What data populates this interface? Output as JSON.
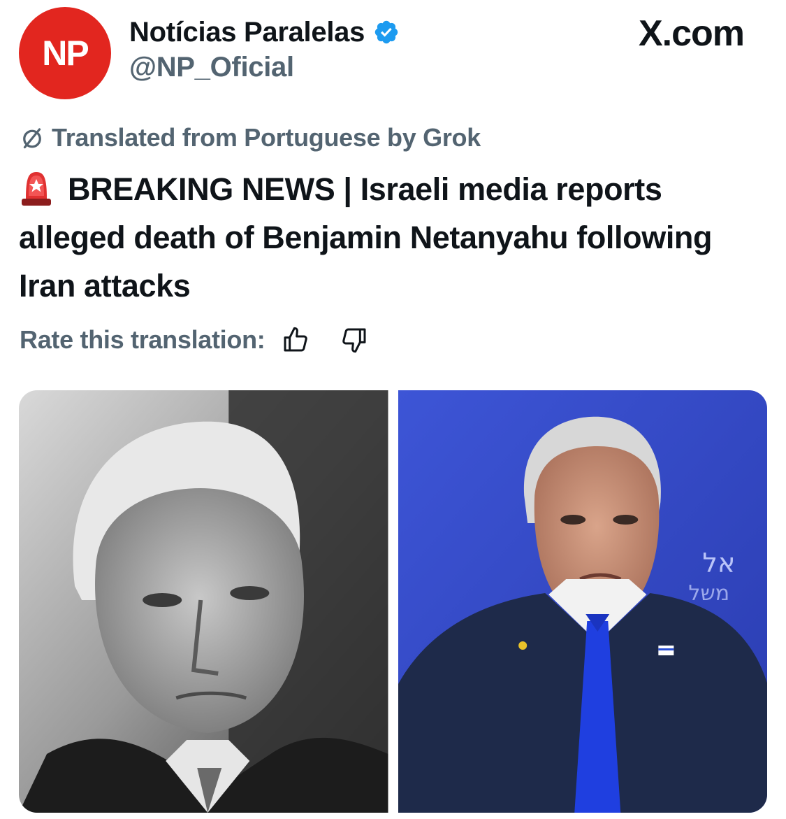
{
  "author": {
    "avatar_text": "NP",
    "display_name": "Notícias Paralelas",
    "handle": "@NP_Oficial",
    "verified_icon": "verified-badge-icon"
  },
  "site": {
    "label": "X.com"
  },
  "translation": {
    "notice": "Translated from Portuguese by Grok",
    "rate_label": "Rate this translation:"
  },
  "tweet": {
    "emoji": "siren-emoji",
    "text": "BREAKING NEWS | Israeli media reports alleged death of Benjamin Netanyahu following Iran attacks"
  },
  "colors": {
    "avatar_bg": "#e2261f",
    "text_primary": "#0f1419",
    "text_secondary": "#536471",
    "verified_blue": "#1d9bf0",
    "photo_right_bg": "#3a4fc8"
  },
  "media": {
    "images": [
      {
        "name": "portrait-grayscale"
      },
      {
        "name": "portrait-blue-background"
      }
    ]
  }
}
